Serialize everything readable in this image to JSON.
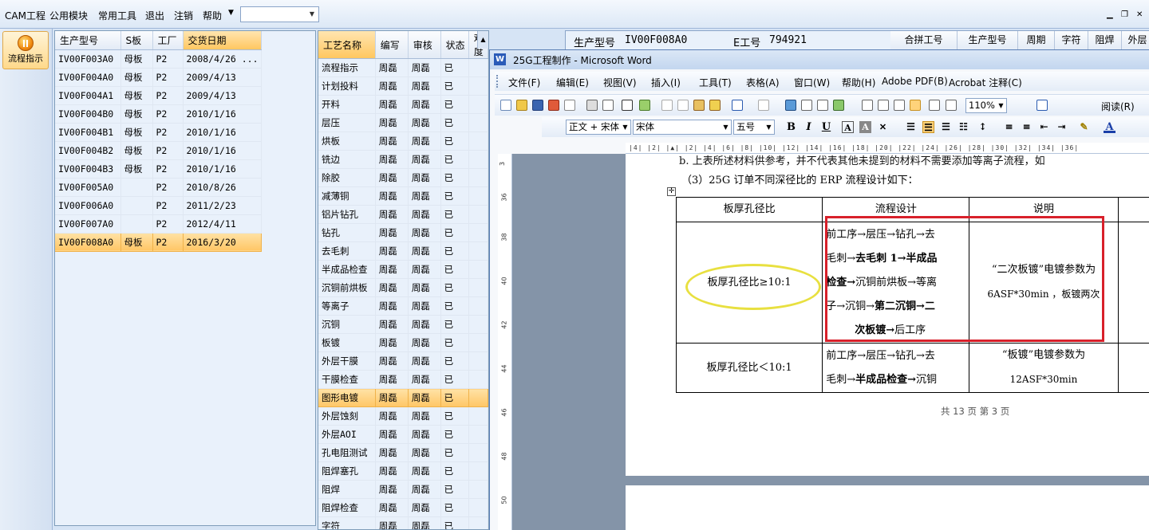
{
  "menubar": {
    "items": [
      "CAM工程",
      "公用模块",
      "常用工具",
      "退出",
      "注销",
      "帮助"
    ],
    "combo_value": ""
  },
  "left_toolbar": {
    "flow_button_label": "流程指示"
  },
  "products": {
    "headers": [
      "生产型号",
      "S板",
      "工厂",
      "交货日期"
    ],
    "rows": [
      [
        "IV00F003A0",
        "母板",
        "P2",
        "2008/4/26 ..."
      ],
      [
        "IV00F004A0",
        "母板",
        "P2",
        "2009/4/13"
      ],
      [
        "IV00F004A1",
        "母板",
        "P2",
        "2009/4/13"
      ],
      [
        "IV00F004B0",
        "母板",
        "P2",
        "2010/1/16"
      ],
      [
        "IV00F004B1",
        "母板",
        "P2",
        "2010/1/16"
      ],
      [
        "IV00F004B2",
        "母板",
        "P2",
        "2010/1/16"
      ],
      [
        "IV00F004B3",
        "母板",
        "P2",
        "2010/1/16"
      ],
      [
        "IV00F005A0",
        "",
        "P2",
        "2010/8/26"
      ],
      [
        "IV00F006A0",
        "",
        "P2",
        "2011/2/23"
      ],
      [
        "IV00F007A0",
        "",
        "P2",
        "2012/4/11"
      ],
      [
        "IV00F008A0",
        "母板",
        "P2",
        "2016/3/20"
      ]
    ],
    "selected_index": 10
  },
  "processes": {
    "headers": [
      "工艺名称",
      "编写",
      "审核",
      "状态",
      "难度"
    ],
    "rows": [
      [
        "流程指示",
        "周磊",
        "周磊",
        "已"
      ],
      [
        "计划投料",
        "周磊",
        "周磊",
        "已"
      ],
      [
        "开料",
        "周磊",
        "周磊",
        "已"
      ],
      [
        "层压",
        "周磊",
        "周磊",
        "已"
      ],
      [
        "烘板",
        "周磊",
        "周磊",
        "已"
      ],
      [
        "铣边",
        "周磊",
        "周磊",
        "已"
      ],
      [
        "除胶",
        "周磊",
        "周磊",
        "已"
      ],
      [
        "减薄铜",
        "周磊",
        "周磊",
        "已"
      ],
      [
        "铝片钻孔",
        "周磊",
        "周磊",
        "已"
      ],
      [
        "钻孔",
        "周磊",
        "周磊",
        "已"
      ],
      [
        "去毛刺",
        "周磊",
        "周磊",
        "已"
      ],
      [
        "半成品检查",
        "周磊",
        "周磊",
        "已"
      ],
      [
        "沉铜前烘板",
        "周磊",
        "周磊",
        "已"
      ],
      [
        "等离子",
        "周磊",
        "周磊",
        "已"
      ],
      [
        "沉铜",
        "周磊",
        "周磊",
        "已"
      ],
      [
        "板镀",
        "周磊",
        "周磊",
        "已"
      ],
      [
        "外层干膜",
        "周磊",
        "周磊",
        "已"
      ],
      [
        "干膜检查",
        "周磊",
        "周磊",
        "已"
      ],
      [
        "图形电镀",
        "周磊",
        "周磊",
        "已"
      ],
      [
        "外层蚀刻",
        "周磊",
        "周磊",
        "已"
      ],
      [
        "外层AOI",
        "周磊",
        "周磊",
        "已"
      ],
      [
        "孔电阻测试",
        "周磊",
        "周磊",
        "已"
      ],
      [
        "阻焊塞孔",
        "周磊",
        "周磊",
        "已"
      ],
      [
        "阻焊",
        "周磊",
        "周磊",
        "已"
      ],
      [
        "阻焊检查",
        "周磊",
        "周磊",
        "已"
      ],
      [
        "字符",
        "周磊",
        "周磊",
        "已"
      ]
    ],
    "selected_index": 18
  },
  "infobar": {
    "prod_label": "生产型号",
    "prod_value": "IV00F008A0",
    "e_label": "E工号",
    "e_value": "794921",
    "right_headers": [
      "合拼工号",
      "生产型号",
      "周期",
      "字符",
      "阻焊",
      "外层"
    ]
  },
  "word": {
    "title": "25G工程制作 - Microsoft Word",
    "menu": [
      "文件(F)",
      "编辑(E)",
      "视图(V)",
      "插入(I)",
      "工具(T)",
      "表格(A)",
      "窗口(W)",
      "帮助(H)",
      "Adobe PDF(B)",
      "Acrobat 注释(C)"
    ],
    "zoom": "110%",
    "reading_btn": "阅读(R)",
    "style": "正文 + 宋体",
    "font": "宋体",
    "size": "五号",
    "doc": {
      "top_cut_line": "b. 上表所述材料供参考，并不代表其他未提到的材料不需要添加等离子流程，如",
      "heading": "（3）25G 订单不同深径比的 ERP 流程设计如下：",
      "table_headers": [
        "板厚孔径比",
        "流程设计",
        "说明"
      ],
      "row1_ratio": "板厚孔径比≥10:1",
      "row1_flow": [
        [
          "前工序→层压→钻孔→去",
          ""
        ],
        [
          "毛刺→",
          "去毛刺 1→半成品"
        ],
        [
          "",
          "检查→",
          "沉铜前烘板→等离"
        ],
        [
          "子→沉铜→",
          "第二沉铜→二"
        ],
        [
          "",
          "次板镀→",
          "后工序"
        ]
      ],
      "row1_note": [
        "“二次板镀”电镀参数为",
        "6ASF*30min ，板镀两次"
      ],
      "row2_ratio": "板厚孔径比＜10:1",
      "row2_flow_1": "前工序→层压→钻孔→去",
      "row2_flow_2a": "毛刺→",
      "row2_flow_2b": "半成品检查→",
      "row2_flow_2c": "沉铜",
      "row2_note": [
        "“板镀”电镀参数为",
        "12ASF*30min"
      ],
      "footer": "共 13 页  第 3 页"
    }
  }
}
